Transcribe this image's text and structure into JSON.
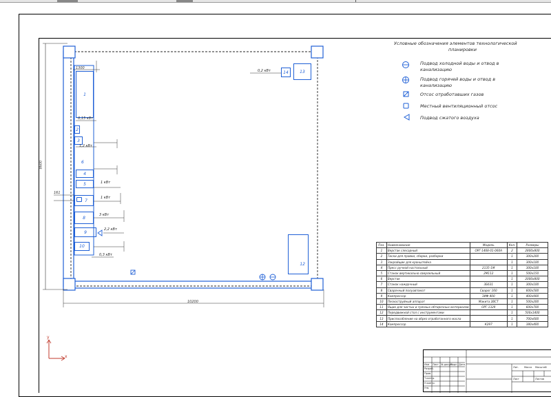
{
  "legend": {
    "title_line1": "Условные обозначения элементов технологической",
    "title_line2": "планировки",
    "items": [
      {
        "icon": "cold-water-icon",
        "line1": "Подвод холодной воды и отвод в",
        "line2": "канализацию"
      },
      {
        "icon": "hot-water-icon",
        "line1": "Подвод горячей воды и отвод в",
        "line2": "канализацию"
      },
      {
        "icon": "exhaust-gas-icon",
        "line1": "Отсос отработавших газов",
        "line2": ""
      },
      {
        "icon": "local-ventilation-icon",
        "line1": "Местный вентиляционный отсос",
        "line2": ""
      },
      {
        "icon": "compressed-air-icon",
        "line1": "Подвод сжатого воздуха",
        "line2": ""
      }
    ]
  },
  "dimensions": {
    "width": "10200",
    "height": "8600",
    "left_offset": "161",
    "top_post": "1300"
  },
  "equipment": {
    "e1": "1",
    "e2": "2",
    "e3": "3",
    "e4": "4",
    "e5": "5",
    "e6": "6",
    "e7": "7",
    "e8": "8",
    "e9": "9",
    "e10": "10",
    "e12": "12",
    "e13": "13",
    "e14": "14"
  },
  "power_labels": {
    "p14": "0,2 кВт",
    "p2": "0,15 кВт",
    "p3": "1,2 кВт",
    "p5": "1 кВт",
    "p7": "1 кВт",
    "p8": "3 кВт",
    "p9": "2,2 кВт",
    "p10": "0,3 кВт"
  },
  "axes": {
    "x": "x",
    "y": "y"
  },
  "spec_table": {
    "headers": [
      "Поз.",
      "Наименование",
      "Модель",
      "Кол.",
      "Размеры"
    ],
    "rows": [
      [
        "1",
        "Верстак слесарный",
        "ОРГ-1468-01-060А",
        "2",
        "2800х800"
      ],
      [
        "2",
        "Тиски для правки, сборки, разборки",
        "",
        "1",
        "300х200"
      ],
      [
        "3",
        "Закройщик для кронштейна",
        "",
        "1",
        "300х100"
      ],
      [
        "4",
        "Пресс ручной настольный",
        "2135-1М",
        "1",
        "300х100"
      ],
      [
        "5",
        "Станок вертикально-сверлильный",
        "2М112",
        "1",
        "500х150"
      ],
      [
        "6",
        "Верстак",
        "",
        "1",
        "2000х800"
      ],
      [
        "7",
        "Станок наждачный",
        "3Б631",
        "1",
        "300х100"
      ],
      [
        "8",
        "Сварочный полуавтомат",
        "Сварог 160",
        "1",
        "600х500"
      ],
      [
        "9",
        "Компрессор",
        "ЗИФ 400",
        "1",
        "400х900"
      ],
      [
        "10",
        "Пескоструйный аппарат",
        "Макита 2ВСТ",
        "1",
        "500х200"
      ],
      [
        "11",
        "Ящик для чистых и грязных обтирочных материалов",
        "ОРГ-1329",
        "1",
        "600х700"
      ],
      [
        "12",
        "Передвижной стол с инструментами",
        "",
        "1",
        "500х1400"
      ],
      [
        "13",
        "Приспособление на обрез отработанного масла",
        "",
        "1",
        "700х600"
      ],
      [
        "14",
        "Компрессор",
        "К297",
        "1",
        "380х400"
      ]
    ]
  },
  "stamp": {
    "labels": [
      "Изм",
      "Лист",
      "№ докум.",
      "Подп.",
      "Дата",
      "Разраб.",
      "Пров.",
      "Т.контр.",
      "Н.контр.",
      "Утв.",
      "Лит.",
      "Масса",
      "Масштаб",
      "Лист",
      "Листов"
    ]
  }
}
